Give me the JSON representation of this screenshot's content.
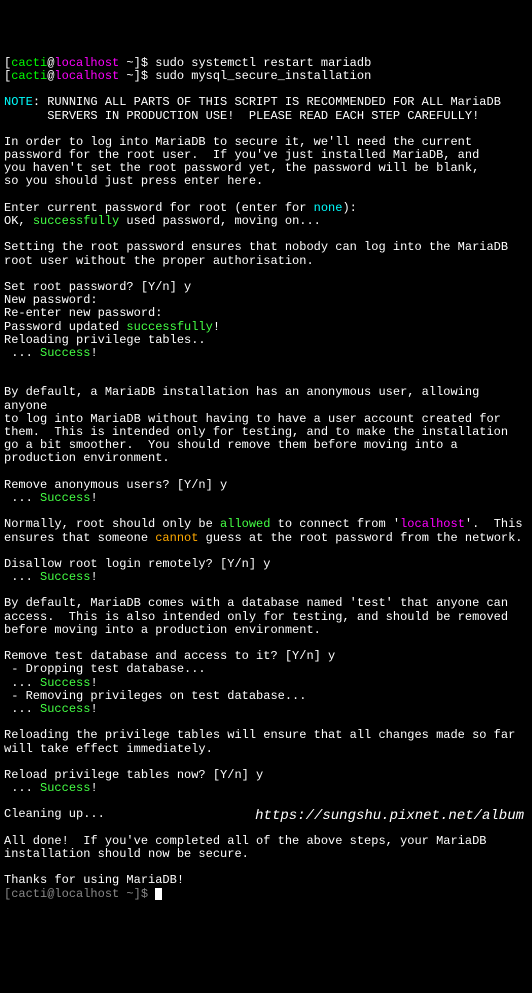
{
  "prompt": {
    "user": "cacti",
    "at": "@",
    "host": "localhost",
    "path": " ~",
    "end": "]$ "
  },
  "commands": {
    "cmd1": "sudo systemctl restart mariadb",
    "cmd2": "sudo mysql_secure_installation"
  },
  "note": {
    "label": "NOTE",
    "text1": ": RUNNING ALL PARTS OF THIS SCRIPT IS RECOMMENDED FOR ALL MariaDB",
    "text2": "      SERVERS IN PRODUCTION USE!  PLEASE READ EACH STEP CAREFULLY!"
  },
  "intro": {
    "l1": "In order to log into MariaDB to secure it, we'll need the current",
    "l2": "password for the root user.  If you've just installed MariaDB, and",
    "l3": "you haven't set the root password yet, the password will be blank,",
    "l4": "so you should just press enter here."
  },
  "password": {
    "prompt": "Enter current password for root (enter for ",
    "none": "none",
    "end": "):",
    "ok": "OK, ",
    "successfully": "successfully",
    "moving": " used password, moving on..."
  },
  "rootpw": {
    "l1": "Setting the root password ensures that nobody can log into the MariaDB",
    "l2": "root user without the proper authorisation.",
    "prompt": "Set root password? [Y/n] y",
    "new": "New password:",
    "reenter": "Re-enter new password:",
    "updated": "Password updated ",
    "successfully": "successfully",
    "excl": "!",
    "reload": "Reloading privilege tables..",
    "dots": " ... ",
    "success": "Success",
    "excl2": "!"
  },
  "anon": {
    "l1": "By default, a MariaDB installation has an anonymous user, allowing anyone",
    "l2": "to log into MariaDB without having to have a user account created for",
    "l3": "them.  This is intended only for testing, and to make the installation",
    "l4": "go a bit smoother.  You should remove them before moving into a",
    "l5": "production environment.",
    "prompt": "Remove anonymous users? [Y/n] y",
    "dots": " ... ",
    "success": "Success",
    "excl": "!"
  },
  "remote": {
    "l1p1": "Normally, root should only be ",
    "allowed": "allowed",
    "l1p2": " to connect from '",
    "localhost": "localhost",
    "l1p3": "'.  This",
    "l2p1": "ensures that someone ",
    "cannot": "cannot",
    "l2p2": " guess at the root password from the network.",
    "prompt": "Disallow root login remotely? [Y/n] y",
    "dots": " ... ",
    "success": "Success",
    "excl": "!"
  },
  "testdb": {
    "l1": "By default, MariaDB comes with a database named 'test' that anyone can",
    "l2": "access.  This is also intended only for testing, and should be removed",
    "l3": "before moving into a production environment.",
    "prompt": "Remove test database and access to it? [Y/n] y",
    "drop": " - Dropping test database...",
    "dots1": " ... ",
    "success1": "Success",
    "excl1": "!",
    "remove": " - Removing privileges on test database...",
    "dots2": " ... ",
    "success2": "Success",
    "excl2": "!"
  },
  "reload": {
    "l1": "Reloading the privilege tables will ensure that all changes made so far",
    "l2": "will take effect immediately.",
    "prompt": "Reload privilege tables now? [Y/n] y",
    "dots": " ... ",
    "success": "Success",
    "excl": "!"
  },
  "cleanup": {
    "text": "Cleaning up..."
  },
  "done": {
    "l1": "All done!  If you've completed all of the above steps, your MariaDB",
    "l2": "installation should now be secure.",
    "thanks": "Thanks for using MariaDB!"
  },
  "watermark": "https://sungshu.pixnet.net/album"
}
